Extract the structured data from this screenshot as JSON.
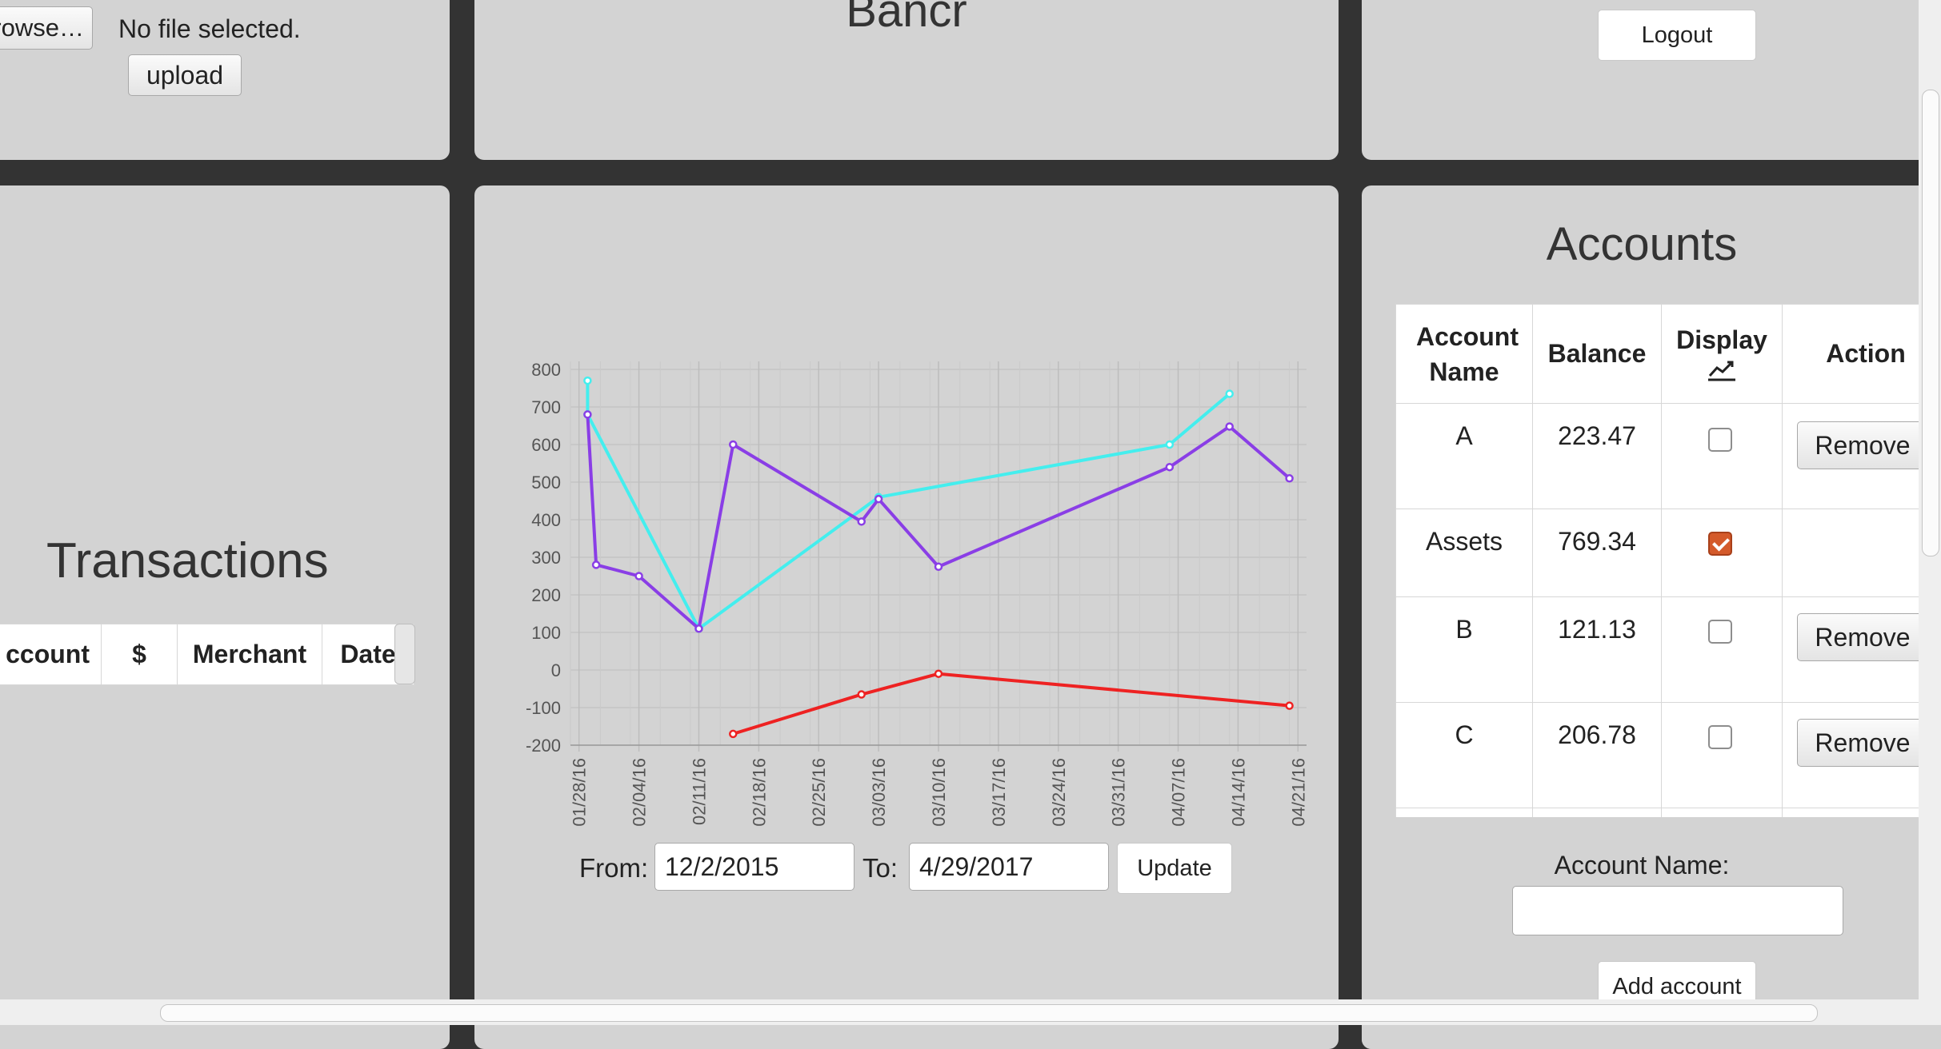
{
  "upload_panel": {
    "browse_label": "rowse…",
    "file_status": "No file selected.",
    "upload_label": "upload"
  },
  "header": {
    "title": "Bancr"
  },
  "user_panel": {
    "logout_label": "Logout"
  },
  "transactions": {
    "title": "Transactions",
    "columns": [
      "ccount",
      "$",
      "Merchant",
      "Date"
    ]
  },
  "chart": {
    "from_label": "From:",
    "from_value": "12/2/2015",
    "to_label": "To:",
    "to_value": "4/29/2017",
    "update_label": "Update"
  },
  "chart_data": {
    "type": "line",
    "title": "",
    "xlabel": "",
    "ylabel": "",
    "ylim": [
      -200,
      800
    ],
    "yticks": [
      800,
      700,
      600,
      500,
      400,
      300,
      200,
      100,
      0,
      -100,
      -200
    ],
    "xtick_labels": [
      "01/28/16",
      "02/04/16",
      "02/11/16",
      "02/18/16",
      "02/25/16",
      "03/03/16",
      "03/10/16",
      "03/17/16",
      "03/24/16",
      "03/31/16",
      "04/07/16",
      "04/14/16",
      "04/21/16"
    ],
    "grid": true,
    "legend": "none",
    "series": [
      {
        "color": "#44eeee",
        "points": [
          [
            "01/29/16",
            770
          ],
          [
            "01/29/16",
            680
          ],
          [
            "02/11/16",
            110
          ],
          [
            "03/03/16",
            460
          ],
          [
            "04/06/16",
            600
          ],
          [
            "04/13/16",
            735
          ]
        ]
      },
      {
        "color": "#8a3ee6",
        "points": [
          [
            "01/29/16",
            680
          ],
          [
            "01/30/16",
            280
          ],
          [
            "02/04/16",
            250
          ],
          [
            "02/11/16",
            110
          ],
          [
            "02/15/16",
            600
          ],
          [
            "03/01/16",
            395
          ],
          [
            "03/03/16",
            455
          ],
          [
            "03/10/16",
            275
          ],
          [
            "04/06/16",
            540
          ],
          [
            "04/13/16",
            648
          ],
          [
            "04/20/16",
            510
          ]
        ]
      },
      {
        "color": "#ee2222",
        "points": [
          [
            "02/15/16",
            -170
          ],
          [
            "03/01/16",
            -65
          ],
          [
            "03/10/16",
            -10
          ],
          [
            "04/20/16",
            -95
          ]
        ]
      }
    ]
  },
  "accounts": {
    "title": "Accounts",
    "columns": {
      "name": "Account Name",
      "balance": "Balance",
      "display": "Display",
      "action": "Action"
    },
    "rows": [
      {
        "name": "A",
        "balance": "223.47",
        "display": false,
        "action": "Remove"
      },
      {
        "name": "Assets",
        "balance": "769.34",
        "display": true,
        "action": ""
      },
      {
        "name": "B",
        "balance": "121.13",
        "display": false,
        "action": "Remove"
      },
      {
        "name": "C",
        "balance": "206.78",
        "display": false,
        "action": "Remove"
      }
    ],
    "name_label": "Account Name:",
    "name_value": "",
    "add_label": "Add account"
  },
  "colors": {
    "panel": "#d3d3d3",
    "background": "#333333",
    "checked": "#d45a2a"
  }
}
